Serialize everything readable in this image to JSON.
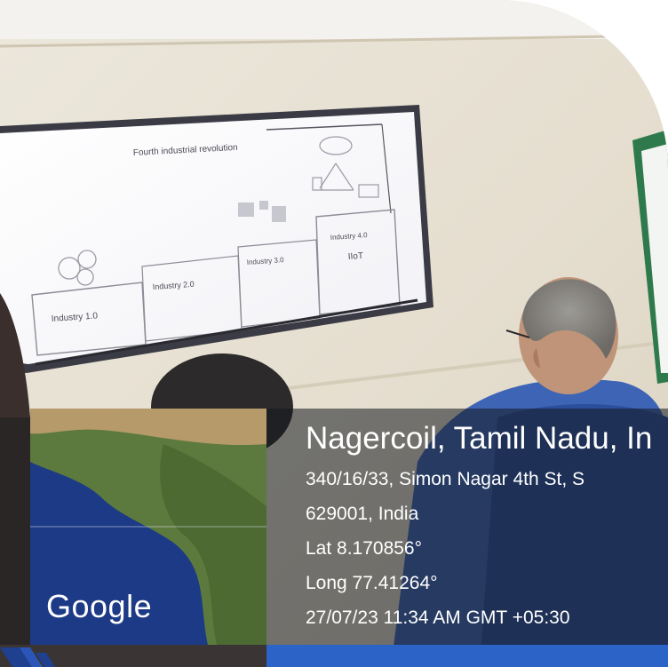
{
  "slide": {
    "title": "Fourth industrial revolution",
    "industry1": "Industry 1.0",
    "industry2": "Industry 2.0",
    "industry3": "Industry 3.0",
    "industry4": "Industry 4.0",
    "iiot": "IIoT"
  },
  "map": {
    "logo": "Google"
  },
  "geotag": {
    "place": "Nagercoil, Tamil Nadu, In",
    "address": "340/16/33, Simon Nagar 4th St, S",
    "postal": "629001, India",
    "lat": "Lat 8.170856°",
    "long": "Long 77.41264°",
    "timestamp": "27/07/23 11:34 AM GMT +05:30"
  },
  "colors": {
    "wall": "#e9e3d7",
    "frame_accent": "#1f3f8f",
    "panel": "#14181e"
  }
}
